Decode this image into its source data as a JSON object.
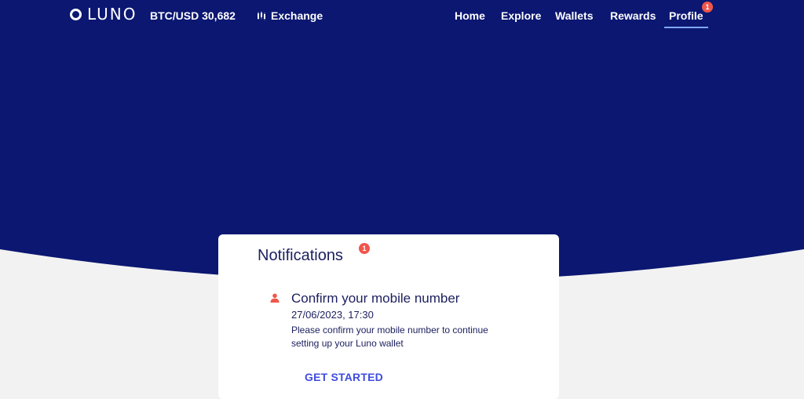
{
  "header": {
    "logo_text": "LUNO",
    "ticker": "BTC/USD 30,682",
    "exchange_label": "Exchange",
    "nav": [
      {
        "label": "Home"
      },
      {
        "label": "Explore"
      },
      {
        "label": "Wallets"
      },
      {
        "label": "Rewards"
      },
      {
        "label": "Profile",
        "badge": "1"
      }
    ]
  },
  "notifications": {
    "title": "Notifications",
    "badge": "1",
    "items": [
      {
        "icon": "person-icon",
        "title": "Confirm your mobile number",
        "date": "27/06/2023, 17:30",
        "body": "Please confirm your mobile number to continue setting up your Luno wallet",
        "action_label": "GET STARTED"
      }
    ]
  },
  "colors": {
    "hero": "#0b1771",
    "page_bg": "#f2f2f2",
    "accent": "#3d4ce0",
    "badge": "#f2554b",
    "text_dark": "#1b1f5e"
  }
}
